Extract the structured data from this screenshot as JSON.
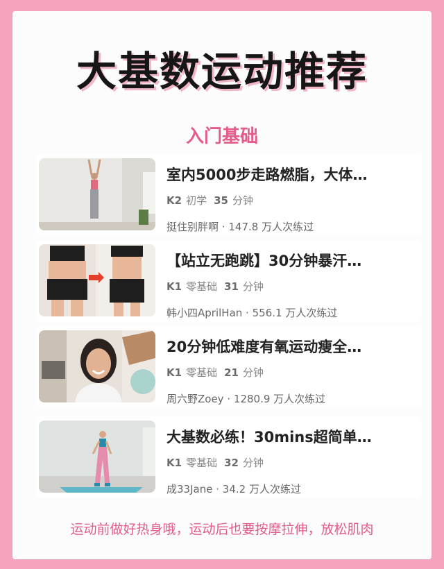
{
  "title": "大基数运动推荐",
  "subtitle": "入门基础",
  "cards": [
    {
      "title": "室内5000步走路燃脂，大体…",
      "level": "K2",
      "difficulty": "初学",
      "minutes": "35",
      "minutes_unit": "分钟",
      "author": "挺住别胖啊",
      "dot": "·",
      "count": "147.8 万人次练过",
      "thumb": "woman-arms-raised-photo"
    },
    {
      "title": "【站立无跑跳】30分钟暴汗…",
      "level": "K1",
      "difficulty": "零基础",
      "minutes": "31",
      "minutes_unit": "分钟",
      "author": "韩小四AprilHan",
      "dot": "·",
      "count": "556.1 万人次练过",
      "thumb": "before-after-waist-photo"
    },
    {
      "title": "20分钟低难度有氧运动瘦全…",
      "level": "K1",
      "difficulty": "零基础",
      "minutes": "21",
      "minutes_unit": "分钟",
      "author": "周六野Zoey",
      "dot": "·",
      "count": "1280.9 万人次练过",
      "thumb": "smiling-woman-portrait-photo"
    },
    {
      "title": "大基数必练！30mins超简单…",
      "level": "K1",
      "difficulty": "零基础",
      "minutes": "32",
      "minutes_unit": "分钟",
      "author": "成33Jane",
      "dot": "·",
      "count": "34.2 万人次练过",
      "thumb": "woman-on-yoga-mat-photo"
    }
  ],
  "footer": "运动前做好热身哦，运动后也要按摩拉伸，放松肌肉",
  "colors": {
    "background": "#f4a3bd",
    "accent": "#e35c8a",
    "text": "#222222"
  }
}
